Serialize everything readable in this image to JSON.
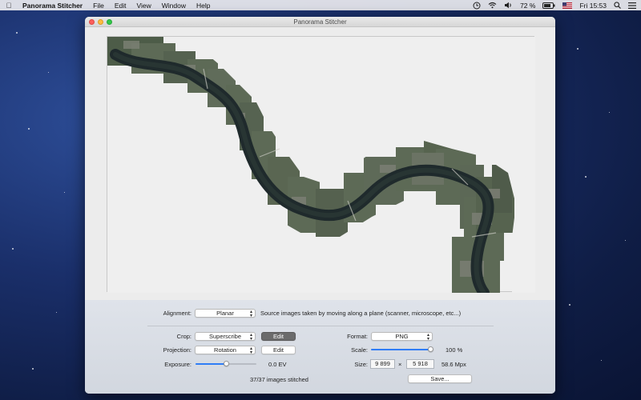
{
  "menubar": {
    "app_name": "Panorama Stitcher",
    "items": [
      "File",
      "Edit",
      "View",
      "Window",
      "Help"
    ],
    "battery_text": "72 %",
    "clock": "Fri 15:53"
  },
  "window": {
    "title": "Panorama Stitcher"
  },
  "controls": {
    "alignment_label": "Alignment:",
    "alignment_value": "Planar",
    "alignment_description": "Source images taken by moving along a plane (scanner, microscope, etc...)",
    "crop_label": "Crop:",
    "crop_value": "Superscribe",
    "crop_edit": "Edit",
    "projection_label": "Projection:",
    "projection_value": "Rotation",
    "projection_edit": "Edit",
    "exposure_label": "Exposure:",
    "exposure_value": "0.0 EV",
    "exposure_slider_fraction": 0.5,
    "format_label": "Format:",
    "format_value": "PNG",
    "scale_label": "Scale:",
    "scale_value": "100 %",
    "scale_slider_fraction": 1.0,
    "size_label": "Size:",
    "size_width": "9 899",
    "size_separator": "×",
    "size_height": "5 918",
    "size_mpx": "58.6 Mpx",
    "status": "37/37 images stitched",
    "save_button": "Save..."
  }
}
